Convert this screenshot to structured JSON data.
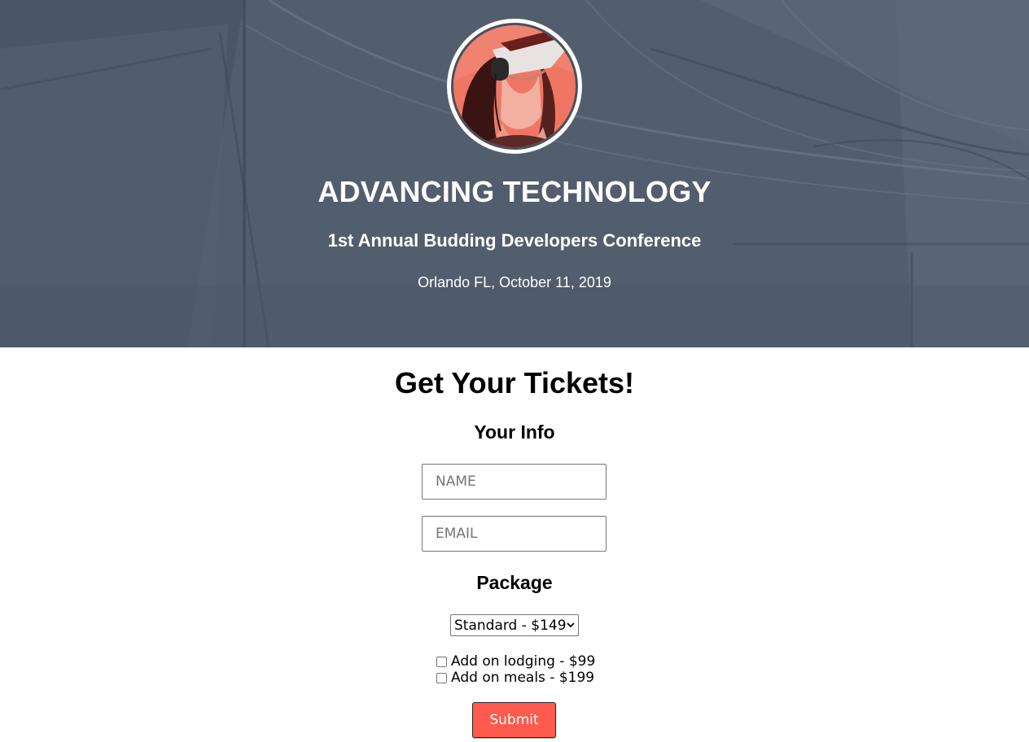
{
  "hero": {
    "title": "ADVANCING TECHNOLOGY",
    "subtitle": "1st Annual Budding Developers Conference",
    "location_date": "Orlando FL, October 11, 2019",
    "overlay_color": "#525e6e"
  },
  "form": {
    "title": "Get Your Tickets!",
    "info_heading": "Your Info",
    "name_placeholder": "NAME",
    "email_placeholder": "EMAIL",
    "package_heading": "Package",
    "package_select": {
      "selected": "Standard - $149"
    },
    "addons": [
      {
        "label": "Add on lodging - $99",
        "checked": false
      },
      {
        "label": "Add on meals - $199",
        "checked": false
      }
    ],
    "submit_label": "Submit",
    "accent_color": "#ff5a4e"
  }
}
